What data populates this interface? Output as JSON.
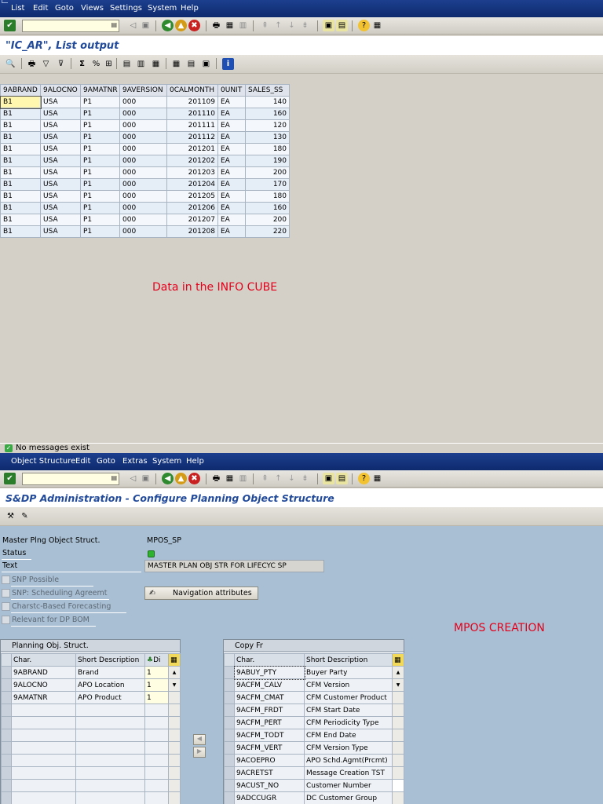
{
  "top": {
    "menu": [
      "List",
      "Edit",
      "Goto",
      "Views",
      "Settings",
      "System",
      "Help"
    ],
    "title": "\"IC_AR\", List output",
    "table": {
      "headers": [
        "9ABRAND",
        "9ALOCNO",
        "9AMATNR",
        "9AVERSION",
        "0CALMONTH",
        "0UNIT",
        "SALES_SS"
      ],
      "rows": [
        [
          "B1",
          "USA",
          "P1",
          "000",
          "201109",
          "EA",
          "140"
        ],
        [
          "B1",
          "USA",
          "P1",
          "000",
          "201110",
          "EA",
          "160"
        ],
        [
          "B1",
          "USA",
          "P1",
          "000",
          "201111",
          "EA",
          "120"
        ],
        [
          "B1",
          "USA",
          "P1",
          "000",
          "201112",
          "EA",
          "130"
        ],
        [
          "B1",
          "USA",
          "P1",
          "000",
          "201201",
          "EA",
          "180"
        ],
        [
          "B1",
          "USA",
          "P1",
          "000",
          "201202",
          "EA",
          "190"
        ],
        [
          "B1",
          "USA",
          "P1",
          "000",
          "201203",
          "EA",
          "200"
        ],
        [
          "B1",
          "USA",
          "P1",
          "000",
          "201204",
          "EA",
          "170"
        ],
        [
          "B1",
          "USA",
          "P1",
          "000",
          "201205",
          "EA",
          "180"
        ],
        [
          "B1",
          "USA",
          "P1",
          "000",
          "201206",
          "EA",
          "160"
        ],
        [
          "B1",
          "USA",
          "P1",
          "000",
          "201207",
          "EA",
          "200"
        ],
        [
          "B1",
          "USA",
          "P1",
          "000",
          "201208",
          "EA",
          "220"
        ]
      ]
    },
    "annotation": "Data in the INFO CUBE",
    "status_message": "No messages exist"
  },
  "bottom": {
    "menu": [
      "Object Structure",
      "Edit",
      "Goto",
      "Extras",
      "System",
      "Help"
    ],
    "title": "S&DP Administration - Configure Planning Object Structure",
    "fields": {
      "master_label": "Master Plng Object Struct.",
      "master_value": "MPOS_SP",
      "status_label": "Status",
      "text_label": "Text",
      "text_value": "MASTER PLAN OBJ STR FOR LIFECYC SP"
    },
    "checkboxes": [
      "SNP Possible",
      "SNP: Scheduling Agreemt",
      "Charstc-Based Forecasting",
      "Relevant for DP BOM"
    ],
    "nav_button": "Navigation attributes",
    "annotation": "MPOS CREATION",
    "left_panel": {
      "title": "Planning Obj. Struct.",
      "headers": [
        "Char.",
        "Short Description",
        "Di"
      ],
      "rows": [
        [
          "9ABRAND",
          "Brand",
          "1"
        ],
        [
          "9ALOCNO",
          "APO Location",
          "1"
        ],
        [
          "9AMATNR",
          "APO Product",
          "1"
        ]
      ]
    },
    "right_panel": {
      "title": "Copy Fr",
      "headers": [
        "Char.",
        "Short Description"
      ],
      "rows": [
        [
          "9ABUY_PTY",
          "Buyer Party"
        ],
        [
          "9ACFM_CALV",
          "CFM Version"
        ],
        [
          "9ACFM_CMAT",
          "CFM Customer Product"
        ],
        [
          "9ACFM_FRDT",
          "CFM Start Date"
        ],
        [
          "9ACFM_PERT",
          "CFM Periodicity Type"
        ],
        [
          "9ACFM_TODT",
          "CFM End Date"
        ],
        [
          "9ACFM_VERT",
          "CFM Version Type"
        ],
        [
          "9ACOEPRO",
          "APO Schd.Agmt(Prcmt)"
        ],
        [
          "9ACRETST",
          "Message Creation TST"
        ],
        [
          "9ACUST_NO",
          "Customer Number"
        ],
        [
          "9ADCCUGR",
          "DC Customer Group"
        ]
      ]
    }
  },
  "colors": {
    "menubar": "#0e2a6e",
    "title_text": "#224a9a",
    "annotation": "#e3001b",
    "status_green": "#2fb32f"
  }
}
